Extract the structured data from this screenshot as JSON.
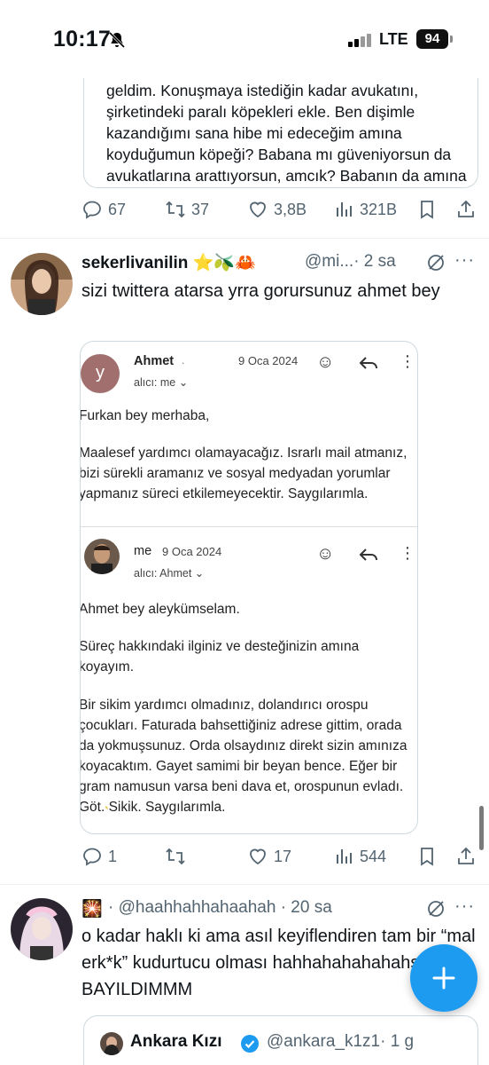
{
  "status_bar": {
    "time": "10:17",
    "network": "LTE",
    "battery": "94"
  },
  "quoted_top": {
    "text": "geldim. Konuşmaya istediğin kadar avukatını, şirketindeki paralı köpekleri ekle. Ben dişimle kazandığımı sana hibe mi edeceğim amına koyduğumun köpeği? Babana mı güveniyorsun da avukatlarına arattıyorsun, amcık? Babanın da amına koydurtma."
  },
  "tweet0_actions": {
    "replies": "67",
    "retweets": "37",
    "likes": "3,8B",
    "views": "321B"
  },
  "tweet1": {
    "name": "sekerlivanilin",
    "emojis": "⭐🫒🦀",
    "handle": "@mi...",
    "time": "· 2 sa",
    "text": "sizi twittera atarsa yrra gorursunuz ahmet bey",
    "actions": {
      "replies": "1",
      "retweets": "",
      "likes": "17",
      "views": "544"
    }
  },
  "email": {
    "msg1": {
      "avatar_letter": "y",
      "sender": "Ahmet",
      "date": "9 Oca 2024",
      "to": "alıcı: me ⌄",
      "greeting": "Furkan bey merhaba,",
      "body": "Maalesef yardımcı olamayacağız. Israrlı mail atmanız, bizi sürekli aramanız ve sosyal medyadan yorumlar yapmanız süreci etkilemeyecektir. Saygılarımla."
    },
    "msg2": {
      "sender": "me",
      "date": "9 Oca 2024",
      "to": "alıcı: Ahmet ⌄",
      "greeting": "Ahmet bey aleykümselam.",
      "para1_a": "Süreç hakkındaki ilginiz ve desteğinizin ",
      "para1_b": "amına koyayım",
      "para1_c": ".",
      "para2_a": "Bir ",
      "para2_b": "sikim",
      "para2_c": " yardımcı olmadınız, dolandırıcı ",
      "para2_d": "orospu çocukları",
      "para2_e": ". Faturada bahsettiğiniz adrese gittim, orada da yokmuşsunuz. Orda olsaydınız direkt sizin ",
      "para2_f": "amınıza",
      "para2_g": " koyacaktım. Gayet samimi bir beyan bence. Eğer bir gram namusun varsa beni dava et, ",
      "para2_h": "orospunun",
      "para2_i": " evladı. ",
      "para2_j": "Göt. Sikik.",
      "para2_k": " Saygılarımla."
    }
  },
  "tweet2": {
    "handle": "@haahhahhahaahah",
    "time": "· 20 sa",
    "text": "o kadar haklı ki ama asıl keyiflendiren tam bir “mal erk*k” kudurtucu olması hahhahahahahahshhs BAYILDIMMM"
  },
  "nested_quote": {
    "name": "Ankara Kızı",
    "handle": "@ankara_k1z1",
    "time": "· 1 g"
  },
  "colors": {
    "accent": "#1d9bf0",
    "muted": "#536471",
    "text": "#0f1419",
    "highlight": "#e8c84a"
  }
}
